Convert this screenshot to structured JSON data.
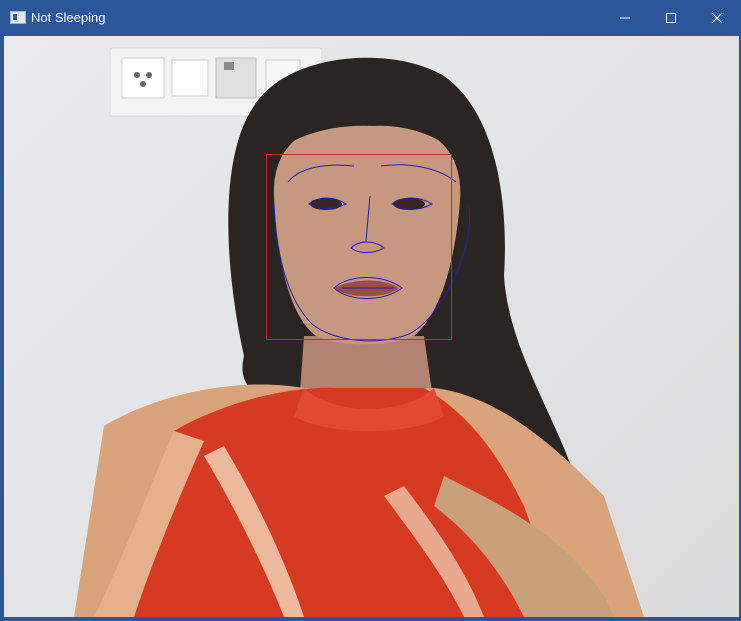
{
  "window": {
    "title": "Not Sleeping",
    "controls": [
      "minimize-icon",
      "maximize-icon",
      "close-icon"
    ]
  },
  "overlay": {
    "face_box_color": "#d4262a",
    "landmark_color": "#1e1eb4"
  },
  "colors": {
    "titlebar": "#2b579a",
    "title_text": "#ffffff"
  }
}
